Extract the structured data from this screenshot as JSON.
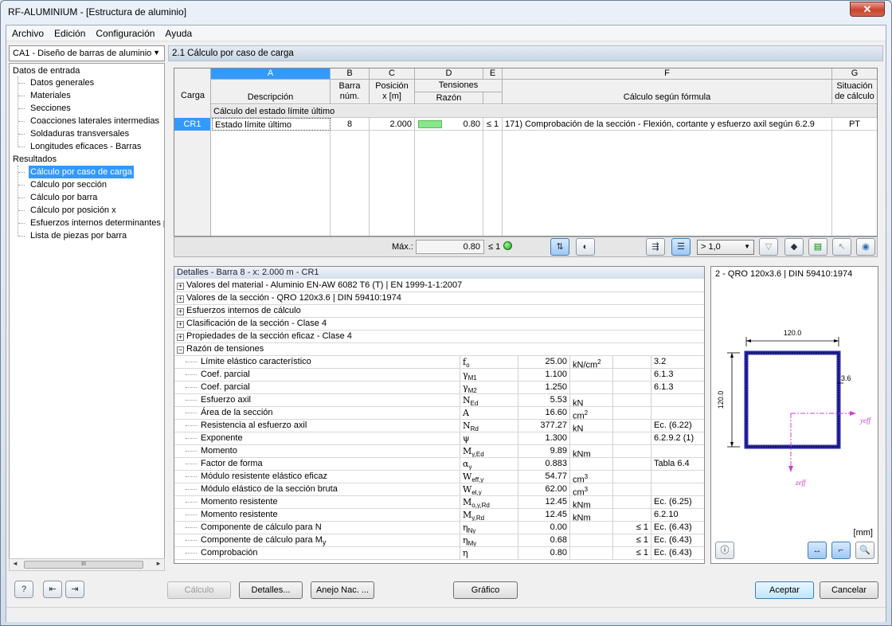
{
  "window": {
    "title": "RF-ALUMINIUM - [Estructura de aluminio]",
    "close_label": "✕"
  },
  "menu": [
    "Archivo",
    "Edición",
    "Configuración",
    "Ayuda"
  ],
  "case_select": "CA1 - Diseño de barras de aluminio",
  "tree": {
    "input_group": "Datos de entrada",
    "input_items": [
      "Datos generales",
      "Materiales",
      "Secciones",
      "Coacciones laterales intermedias",
      "Soldaduras transversales",
      "Longitudes eficaces - Barras"
    ],
    "results_group": "Resultados",
    "results_items": [
      "Cálculo por caso de carga",
      "Cálculo por sección",
      "Cálculo por barra",
      "Cálculo por posición x",
      "Esfuerzos internos determinantes p",
      "Lista de piezas por barra"
    ],
    "selected": "Cálculo por caso de carga",
    "scroll_mark": "III"
  },
  "section_title": "2.1 Cálculo por caso de carga",
  "grid": {
    "col_letters": [
      "A",
      "B",
      "C",
      "D",
      "E",
      "F",
      "G"
    ],
    "headers": {
      "carga": "Carga",
      "a": "Descripción",
      "b1": "Barra",
      "b2": "núm.",
      "c1": "Posición",
      "c2": "x [m]",
      "d1": "Tensiones",
      "d2": "Razón",
      "f": "Cálculo según fórmula",
      "g1": "Situación",
      "g2": "de cálculo"
    },
    "group_row": "Cálculo del estado límite último",
    "row": {
      "carga": "CR1",
      "desc": "Estado límite último",
      "barra": "8",
      "pos": "2.000",
      "razon": "0.80",
      "le": "≤ 1",
      "formula": "171) Comprobación de la sección - Flexión, cortante y esfuerzo axil según 6.2.9",
      "sit": "PT",
      "ratio": 0.8
    }
  },
  "summary": {
    "max_label": "Máx.:",
    "max_value": "0.80",
    "le": "≤ 1",
    "filter": "> 1,0"
  },
  "details": {
    "title": "Detalles - Barra 8 - x: 2.000 m - CR1",
    "groups": [
      "Valores del material - Aluminio EN-AW 6082 T6 (T) | EN 1999-1-1:2007",
      "Valores de la sección  -  QRO 120x3.6 | DIN 59410:1974",
      "Esfuerzos internos de cálculo",
      "Clasificación de la sección - Clase 4",
      "Propiedades de la sección eficaz - Clase 4",
      "Razón de tensiones"
    ],
    "rows": [
      {
        "name": "Límite elástico característico",
        "sym": "f",
        "sub": "o",
        "val": "25.00",
        "unit": "kN/cm",
        "sup": "2",
        "le": "",
        "ref": "3.2"
      },
      {
        "name": "Coef. parcial",
        "sym": "γ",
        "sub": "M1",
        "val": "1.100",
        "unit": "",
        "sup": "",
        "le": "",
        "ref": "6.1.3"
      },
      {
        "name": "Coef. parcial",
        "sym": "γ",
        "sub": "M2",
        "val": "1.250",
        "unit": "",
        "sup": "",
        "le": "",
        "ref": "6.1.3"
      },
      {
        "name": "Esfuerzo axil",
        "sym": "N",
        "sub": "Ed",
        "val": "5.53",
        "unit": "kN",
        "sup": "",
        "le": "",
        "ref": ""
      },
      {
        "name": "Área de la sección",
        "sym": "A",
        "sub": "",
        "val": "16.60",
        "unit": "cm",
        "sup": "2",
        "le": "",
        "ref": ""
      },
      {
        "name": "Resistencia al esfuerzo axil",
        "sym": "N",
        "sub": "Rd",
        "val": "377.27",
        "unit": "kN",
        "sup": "",
        "le": "",
        "ref": "Ec. (6.22)"
      },
      {
        "name": "Exponente",
        "sym": "ψ",
        "sub": "",
        "val": "1.300",
        "unit": "",
        "sup": "",
        "le": "",
        "ref": "6.2.9.2 (1)"
      },
      {
        "name": "Momento",
        "sym": "M",
        "sub": "y,Ed",
        "val": "9.89",
        "unit": "kNm",
        "sup": "",
        "le": "",
        "ref": ""
      },
      {
        "name": "Factor de forma",
        "sym": "α",
        "sub": "y",
        "val": "0.883",
        "unit": "",
        "sup": "",
        "le": "",
        "ref": "Tabla 6.4"
      },
      {
        "name": "Módulo resistente elástico eficaz",
        "sym": "W",
        "sub": "eff,y",
        "val": "54.77",
        "unit": "cm",
        "sup": "3",
        "le": "",
        "ref": ""
      },
      {
        "name": "Módulo elástico de la sección bruta",
        "sym": "W",
        "sub": "el,y",
        "val": "62.00",
        "unit": "cm",
        "sup": "3",
        "le": "",
        "ref": ""
      },
      {
        "name": "Momento resistente",
        "sym": "M",
        "sub": "o,y,Rd",
        "val": "12.45",
        "unit": "kNm",
        "sup": "",
        "le": "",
        "ref": "Ec. (6.25)"
      },
      {
        "name": "Momento resistente",
        "sym": "M",
        "sub": "y,Rd",
        "val": "12.45",
        "unit": "kNm",
        "sup": "",
        "le": "",
        "ref": "6.2.10"
      },
      {
        "name": "Componente de cálculo para N",
        "sym": "η",
        "sub": "Ny",
        "val": "0.00",
        "unit": "",
        "sup": "",
        "le": "≤ 1",
        "ref": "Ec. (6.43)"
      },
      {
        "name": "Componente de cálculo para M",
        "namesub": "y",
        "sym": "η",
        "sub": "My",
        "val": "0.68",
        "unit": "",
        "sup": "",
        "le": "≤ 1",
        "ref": "Ec. (6.43)"
      },
      {
        "name": "Comprobación",
        "sym": "η",
        "sub": "",
        "val": "0.80",
        "unit": "",
        "sup": "",
        "le": "≤ 1",
        "ref": "Ec. (6.43)"
      }
    ]
  },
  "section_graphic": {
    "title": "2 - QRO 120x3.6 | DIN 59410:1974",
    "width_label": "120.0",
    "height_label": "120.0",
    "thick_label": "3.6",
    "y_axis": "yeff",
    "z_axis": "zeff",
    "units": "[mm]",
    "colors": {
      "profile": "#2a2ab0",
      "axis": "#d040d0"
    }
  },
  "buttons": {
    "calc": "Cálculo",
    "details": "Detalles...",
    "annex": "Anejo Nac. ...",
    "graphic": "Gráfico",
    "ok": "Aceptar",
    "cancel": "Cancelar"
  }
}
